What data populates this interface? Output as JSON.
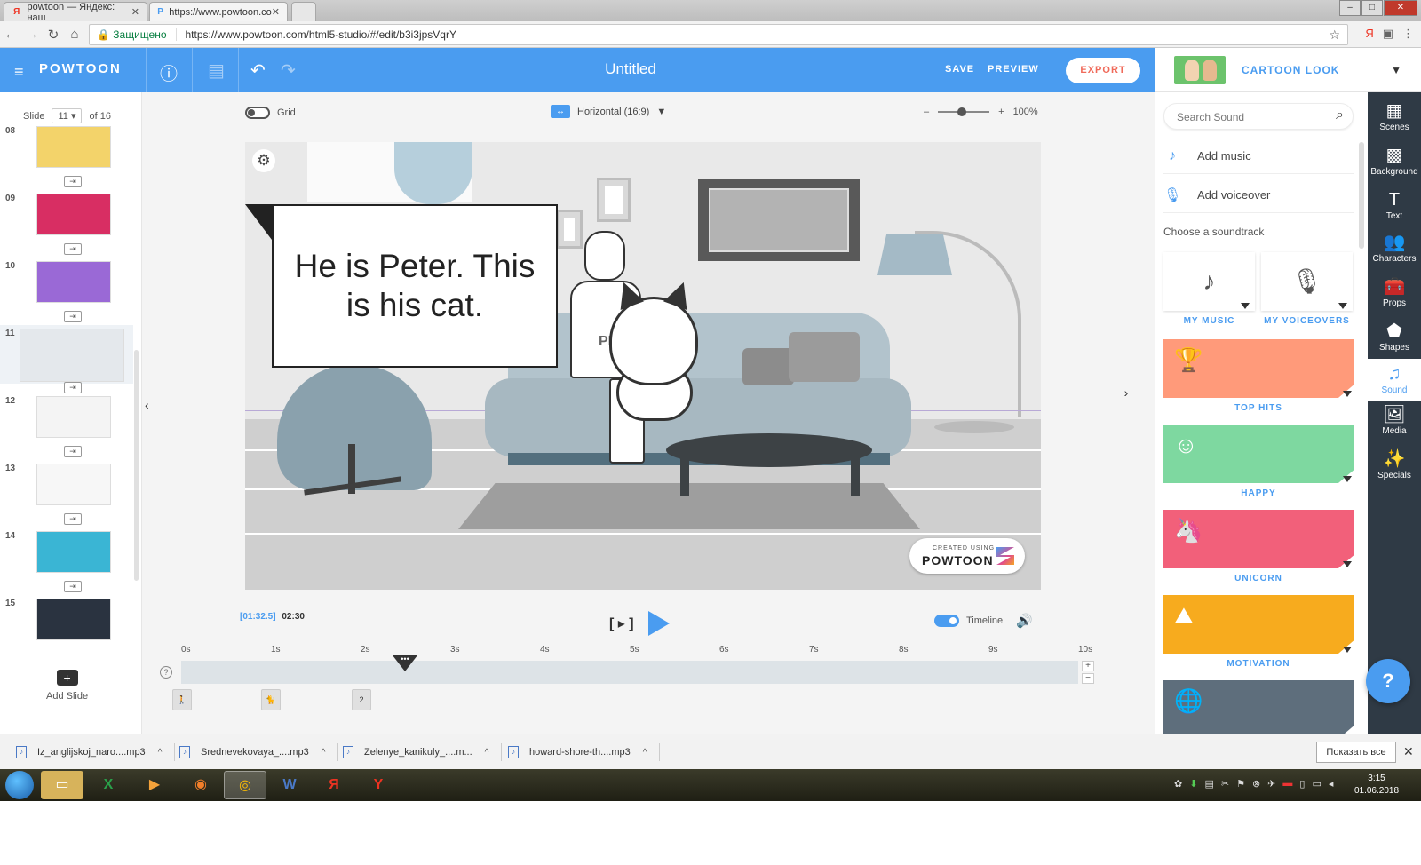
{
  "browser": {
    "tabs": [
      {
        "title": "powtoon — Яндекс: наш"
      },
      {
        "title": "https://www.powtoon.co"
      }
    ],
    "secure_label": "Защищено",
    "url": "https://www.powtoon.com/html5-studio/#/edit/b3i3jpsVqrY"
  },
  "header": {
    "logo": "POWTOON",
    "title": "Untitled",
    "save": "SAVE",
    "preview": "PREVIEW",
    "export": "EXPORT",
    "style_name": "CARTOON LOOK"
  },
  "slides": {
    "label": "Slide",
    "current": "11",
    "of": "of 16",
    "items": [
      {
        "num": "08",
        "color": "#f3d36a"
      },
      {
        "num": "09",
        "color": "#d82e63"
      },
      {
        "num": "10",
        "color": "#9a69d6"
      },
      {
        "num": "11",
        "color": "#e4e8ec"
      },
      {
        "num": "12",
        "color": "#f4f4f4"
      },
      {
        "num": "13",
        "color": "#f7f7f7"
      },
      {
        "num": "14",
        "color": "#3ab5d4"
      },
      {
        "num": "15",
        "color": "#2a3340"
      }
    ],
    "add_label": "Add Slide"
  },
  "canvas": {
    "grid_label": "Grid",
    "aspect_label": "Horizontal (16:9)",
    "zoom_minus": "–",
    "zoom_plus": "+",
    "zoom_value": "100%",
    "bubble_text": "He is Peter. This is his cat.",
    "badge_small": "CREATED USING",
    "badge_big": "POWTOON",
    "shirt_letters": "PR"
  },
  "timeline": {
    "current": "[01:32.5]",
    "total": "02:30",
    "bracket_play": "[ ▸ ]",
    "toggle_label": "Timeline",
    "ticks": [
      "0s",
      "1s",
      "2s",
      "3s",
      "4s",
      "5s",
      "6s",
      "7s",
      "8s",
      "9s",
      "10s"
    ],
    "playhead_label": "•••",
    "help": "?",
    "plus": "+",
    "minus": "−",
    "track_items": [
      "🚶",
      "🐈",
      "2"
    ]
  },
  "sound_panel": {
    "search_placeholder": "Search Sound",
    "add_music": "Add music",
    "add_voiceover": "Add voiceover",
    "choose": "Choose a soundtrack",
    "sources": [
      {
        "label": "MY MUSIC",
        "icon": "♪"
      },
      {
        "label": "MY VOICEOVERS",
        "icon": "🎙"
      }
    ],
    "genres": [
      {
        "label": "TOP HITS",
        "color": "#ff9a7a",
        "icon": "🏆"
      },
      {
        "label": "HAPPY",
        "color": "#7ed8a0",
        "icon": "☺"
      },
      {
        "label": "UNICORN",
        "color": "#f2607a",
        "icon": "🦄"
      },
      {
        "label": "MOTIVATION",
        "color": "#f7ab1e",
        "icon": "⛰"
      },
      {
        "label": "",
        "color": "#5e6e7c",
        "icon": "🌐"
      }
    ]
  },
  "toolbar": {
    "items": [
      {
        "label": "Scenes",
        "icon": "▦"
      },
      {
        "label": "Background",
        "icon": "▩"
      },
      {
        "label": "Text",
        "icon": "T"
      },
      {
        "label": "Characters",
        "icon": "👥"
      },
      {
        "label": "Props",
        "icon": "🧰"
      },
      {
        "label": "Shapes",
        "icon": "⬟"
      },
      {
        "label": "Sound",
        "icon": "♫"
      },
      {
        "label": "Media",
        "icon": "🖼"
      },
      {
        "label": "Specials",
        "icon": "✨"
      }
    ],
    "help": "?"
  },
  "downloads": {
    "items": [
      "Iz_anglijskoj_naro....mp3",
      "Srednevekovaya_....mp3",
      "Zelenye_kanikuly_....m...",
      "howard-shore-th....mp3"
    ],
    "show_all": "Показать все"
  },
  "taskbar": {
    "time": "3:15",
    "date": "01.06.2018"
  }
}
